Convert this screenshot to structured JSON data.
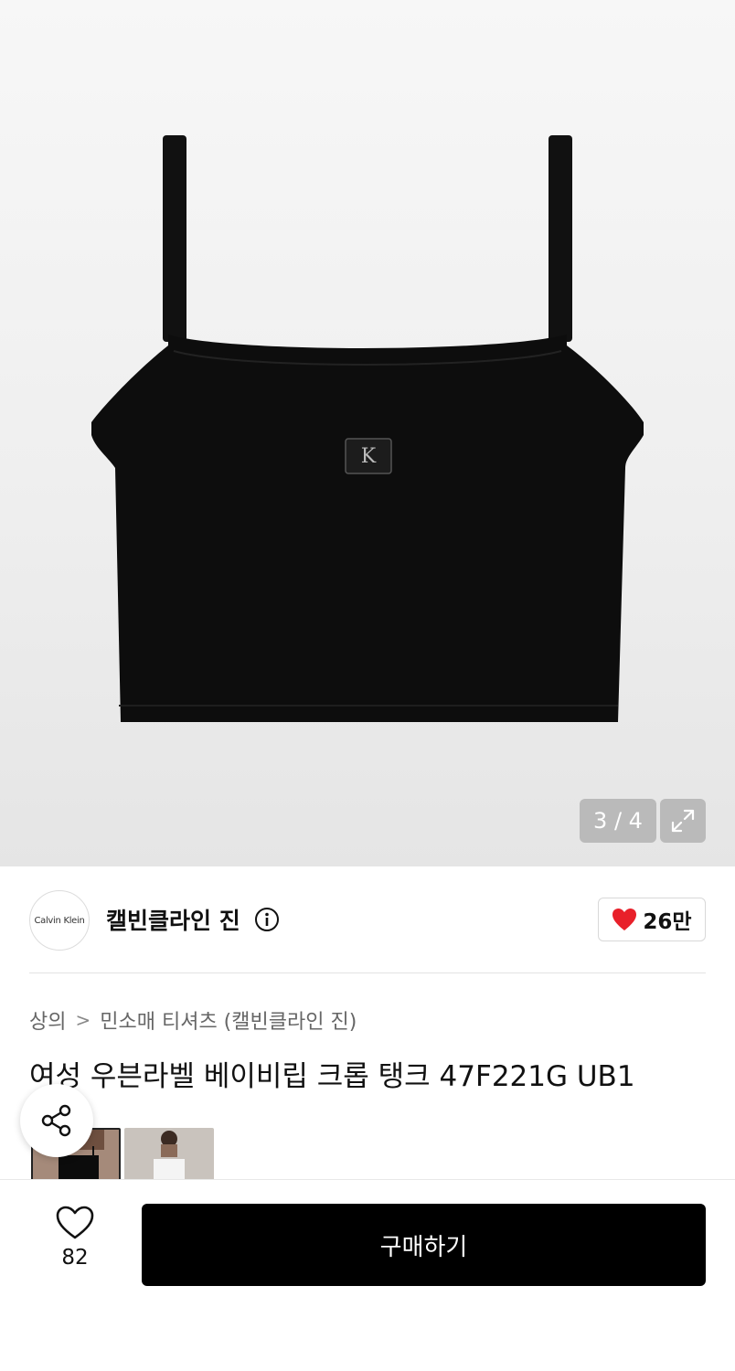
{
  "gallery": {
    "counter": "3 / 4",
    "expand_icon": "expand-icon"
  },
  "brand": {
    "logo_text": "Calvin Klein",
    "name": "캘빈클라인 진",
    "info_icon": "info-icon",
    "like_count": "26만",
    "like_color": "#e8202a"
  },
  "breadcrumb": {
    "category": "상의",
    "separator": ">",
    "subcategory": "민소매 티셔츠 (캘빈클라인 진)"
  },
  "product": {
    "title": "여성 우븐라벨 베이비립 크롭 탱크 47F221G UB1"
  },
  "bottom_bar": {
    "wish_count": "82",
    "buy_label": "구매하기"
  }
}
